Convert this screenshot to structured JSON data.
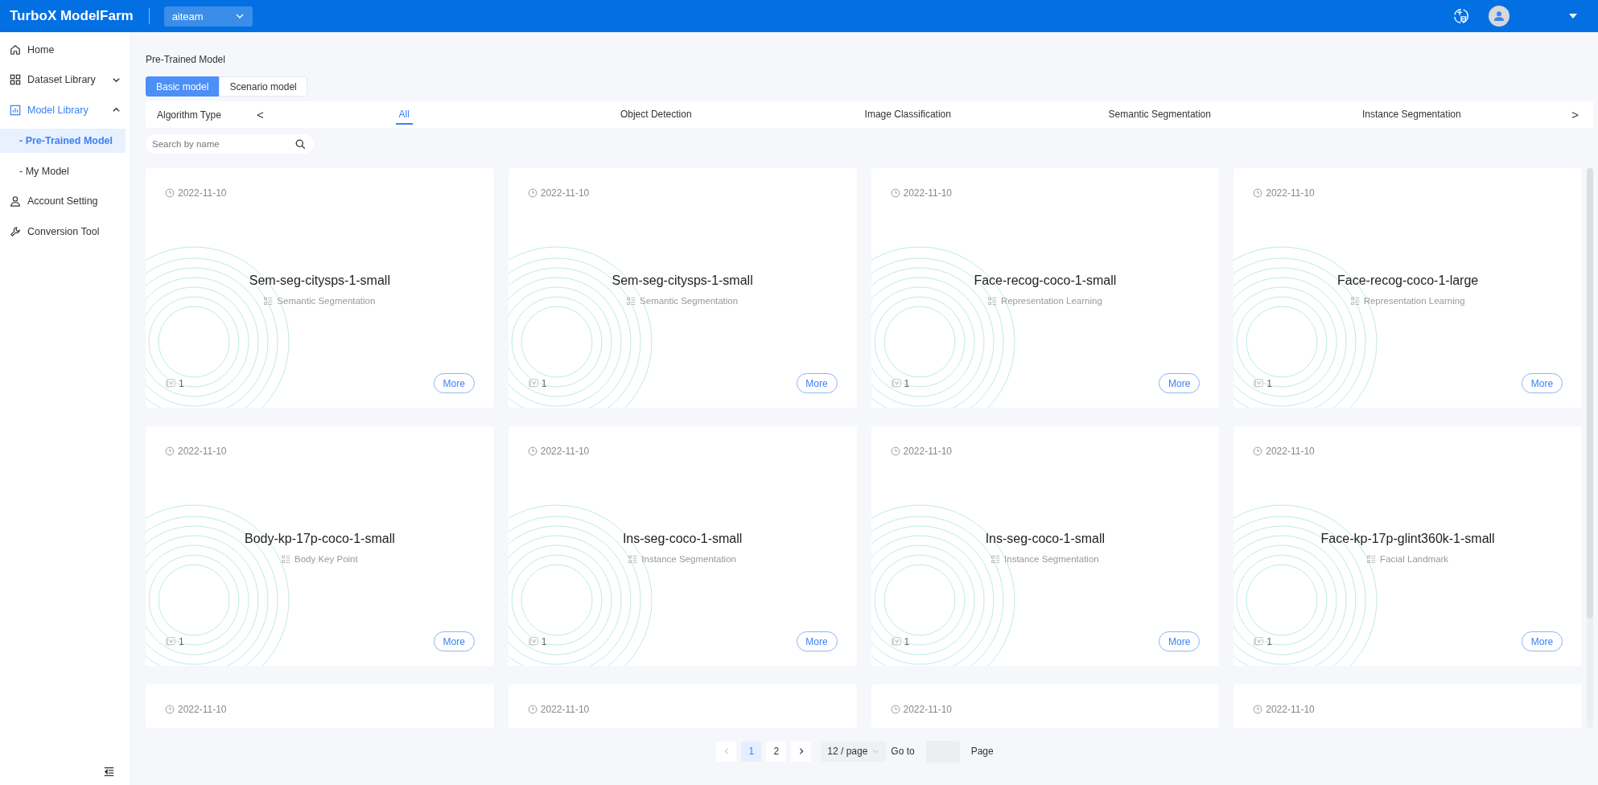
{
  "header": {
    "logo": "TurboX ModelFarm",
    "workspace": "aiteam"
  },
  "sidebar": {
    "items": [
      {
        "label": "Home",
        "selected": false
      },
      {
        "label": "Dataset Library",
        "expanded": false,
        "selected": false
      },
      {
        "label": "Model Library",
        "expanded": true,
        "selected": true,
        "children": [
          {
            "label": "- Pre-Trained Model",
            "selected": true
          },
          {
            "label": "- My Model",
            "selected": false
          }
        ]
      },
      {
        "label": "Account Setting",
        "selected": false
      },
      {
        "label": "Conversion Tool",
        "selected": false
      }
    ]
  },
  "breadcrumb": "Pre-Trained Model",
  "model_tabs": [
    {
      "label": "Basic model",
      "selected": true
    },
    {
      "label": "Scenario model",
      "selected": false
    }
  ],
  "algorithm_filter": {
    "label": "Algorithm Type",
    "prev": "<",
    "next": ">",
    "tabs": [
      {
        "label": "All",
        "selected": true
      },
      {
        "label": "Object Detection",
        "selected": false
      },
      {
        "label": "Image Classification",
        "selected": false
      },
      {
        "label": "Semantic Segmentation",
        "selected": false
      },
      {
        "label": "Instance Segmentation",
        "selected": false
      }
    ]
  },
  "search": {
    "placeholder": "Search by name"
  },
  "cards": [
    {
      "date": "2022-11-10",
      "name": "Sem-seg-citysps-1-small",
      "type": "Semantic Segmentation",
      "count": "1",
      "button": "More"
    },
    {
      "date": "2022-11-10",
      "name": "Sem-seg-citysps-1-small",
      "type": "Semantic Segmentation",
      "count": "1",
      "button": "More"
    },
    {
      "date": "2022-11-10",
      "name": "Face-recog-coco-1-small",
      "type": "Representation Learning",
      "count": "1",
      "button": "More"
    },
    {
      "date": "2022-11-10",
      "name": "Face-recog-coco-1-large",
      "type": "Representation Learning",
      "count": "1",
      "button": "More"
    },
    {
      "date": "2022-11-10",
      "name": "Body-kp-17p-coco-1-small",
      "type": "Body Key Point",
      "count": "1",
      "button": "More"
    },
    {
      "date": "2022-11-10",
      "name": "Ins-seg-coco-1-small",
      "type": "Instance Segmentation",
      "count": "1",
      "button": "More"
    },
    {
      "date": "2022-11-10",
      "name": "Ins-seg-coco-1-small",
      "type": "Instance Segmentation",
      "count": "1",
      "button": "More"
    },
    {
      "date": "2022-11-10",
      "name": "Face-kp-17p-glint360k-1-small",
      "type": "Facial Landmark",
      "count": "1",
      "button": "More"
    },
    {
      "date": "2022-11-10"
    },
    {
      "date": "2022-11-10"
    },
    {
      "date": "2022-11-10"
    },
    {
      "date": "2022-11-10"
    }
  ],
  "pagination": {
    "prev_disabled": true,
    "pages": [
      {
        "label": "1",
        "selected": true
      },
      {
        "label": "2",
        "selected": false
      }
    ],
    "page_size": "12 / page",
    "goto_label": "Go to",
    "page_suffix": "Page"
  }
}
